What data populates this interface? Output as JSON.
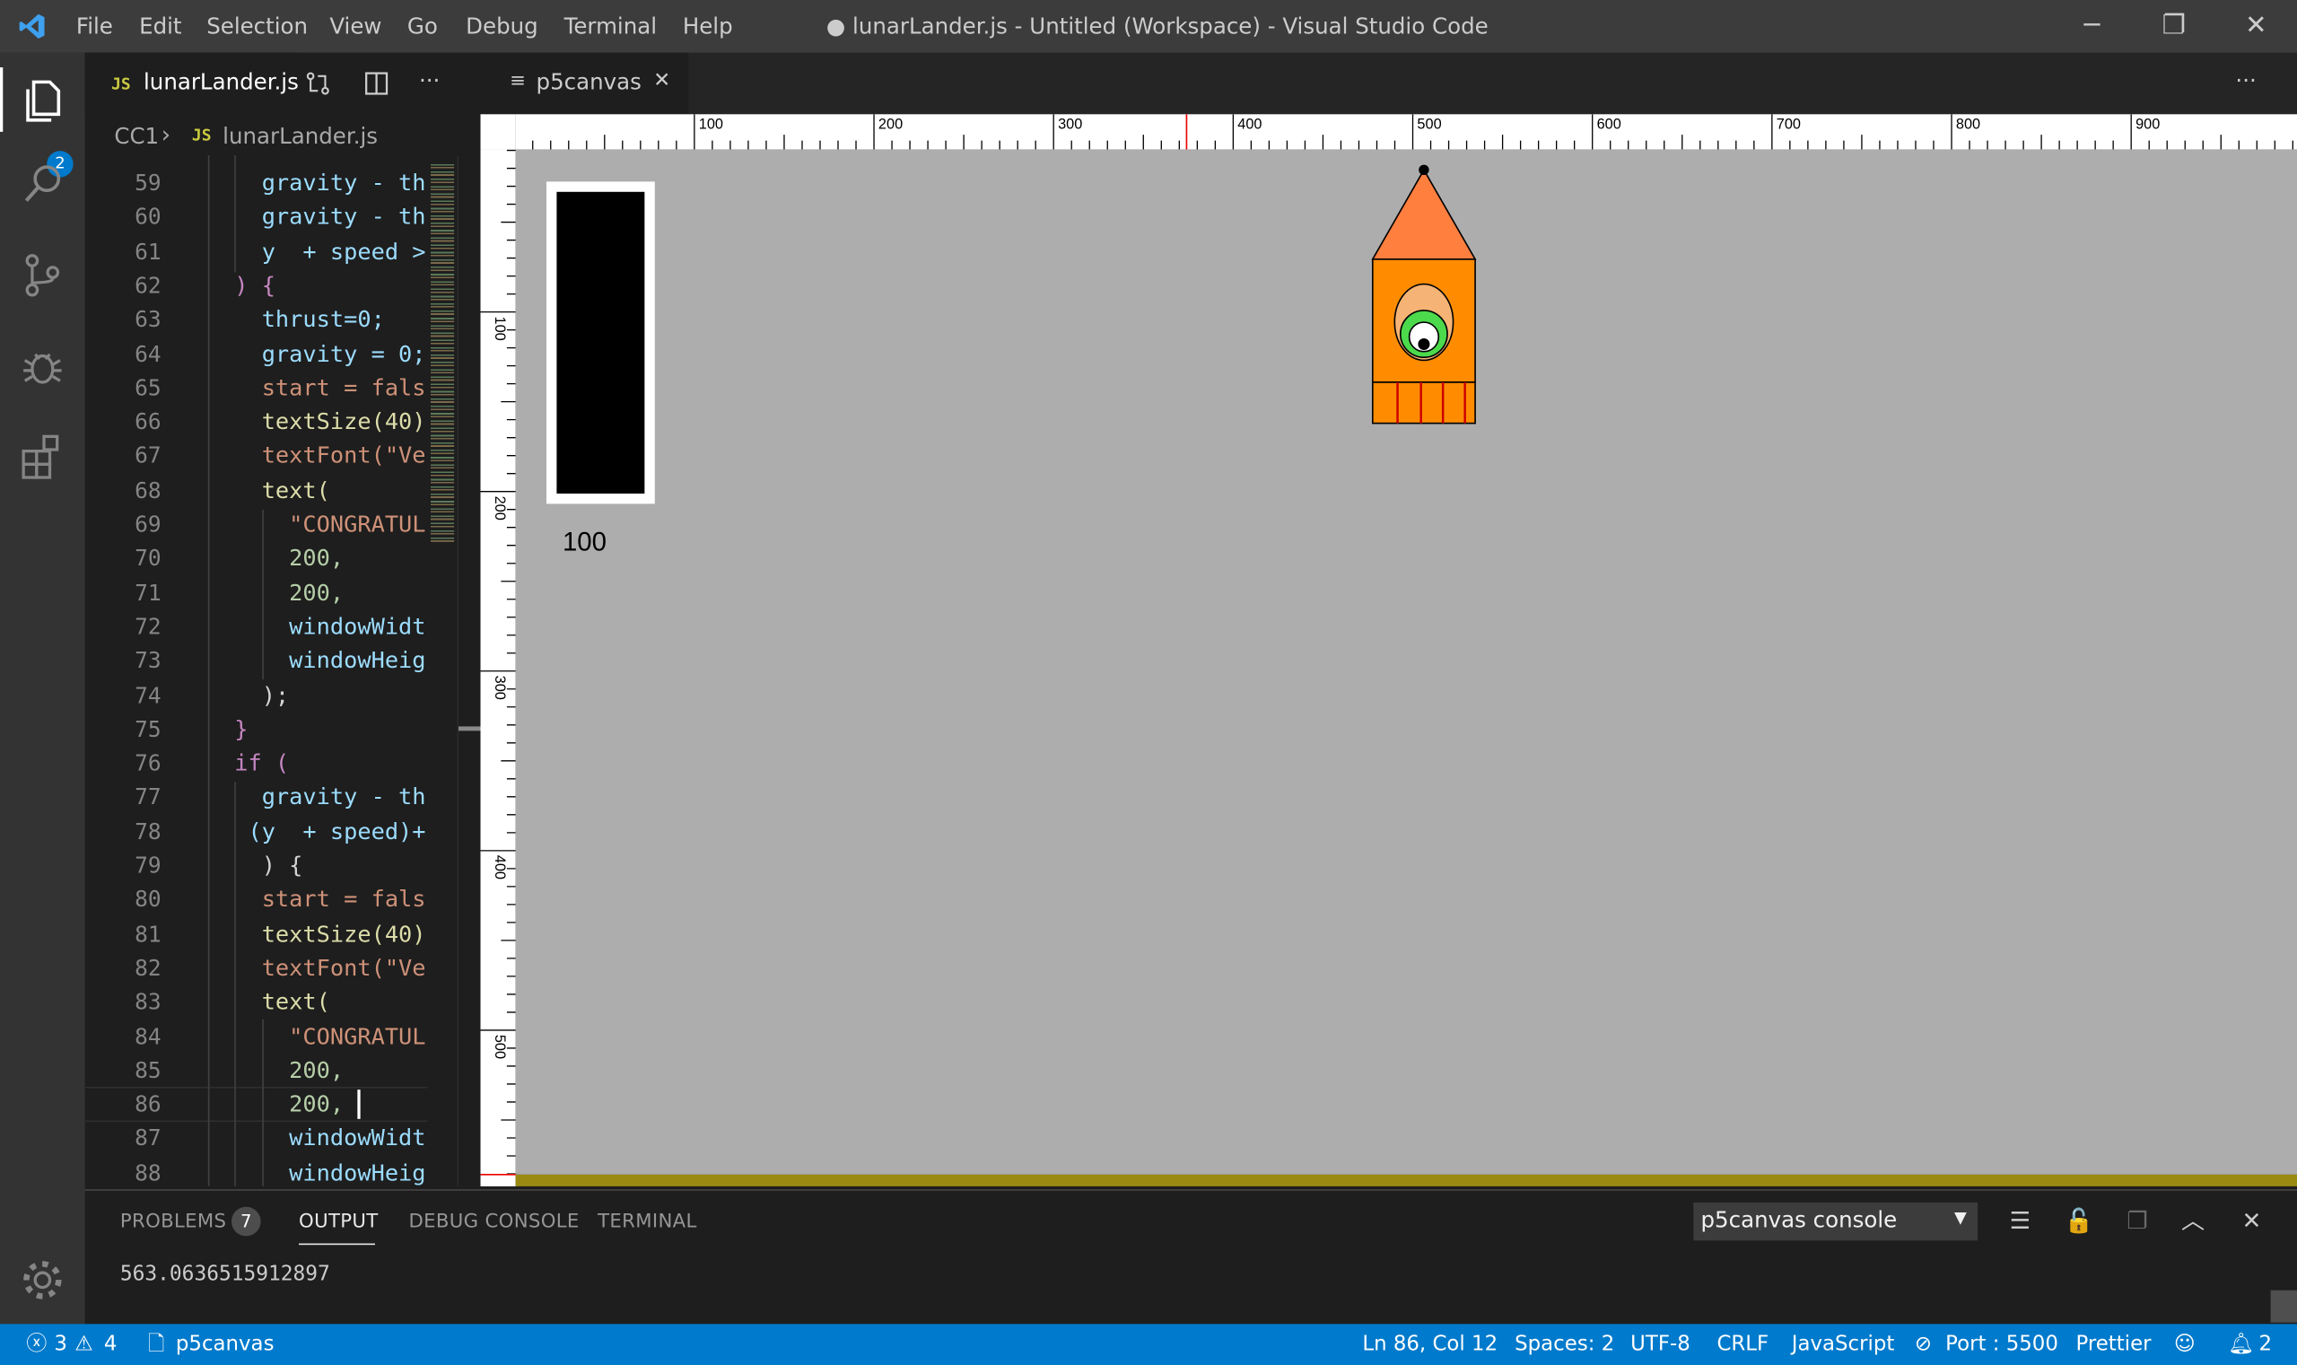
{
  "app": {
    "window_title": "● lunarLander.js - Untitled (Workspace) - Visual Studio Code",
    "menu": [
      "File",
      "Edit",
      "Selection",
      "View",
      "Go",
      "Debug",
      "Terminal",
      "Help"
    ],
    "window_controls": {
      "minimize": "─",
      "restore": "❐",
      "close": "✕"
    }
  },
  "activity_bar": {
    "explorer_badge": "2",
    "items": [
      "files-icon",
      "search-icon",
      "source-control-icon",
      "debug-icon",
      "extensions-icon",
      "settings-gear-icon"
    ]
  },
  "left_editor": {
    "tab_label": "lunarLander.js",
    "tab_lang": "JS",
    "more_actions": "···",
    "breadcrumb": {
      "folder": "CC1",
      "lang": "JS",
      "file": "lunarLander.js"
    },
    "lines": [
      {
        "n": "59",
        "t": "  gravity - th"
      },
      {
        "n": "60",
        "t": "  gravity - th"
      },
      {
        "n": "61",
        "t": "  y  + speed >"
      },
      {
        "n": "62",
        "t": ") {"
      },
      {
        "n": "63",
        "t": "  thrust=0;"
      },
      {
        "n": "64",
        "t": "  gravity = 0;"
      },
      {
        "n": "65",
        "t": "  start = fals"
      },
      {
        "n": "66",
        "t": "  textSize(40)"
      },
      {
        "n": "67",
        "t": "  textFont(\"Ve"
      },
      {
        "n": "68",
        "t": "  text("
      },
      {
        "n": "69",
        "t": "    \"CONGRATUL"
      },
      {
        "n": "70",
        "t": "    200,"
      },
      {
        "n": "71",
        "t": "    200,"
      },
      {
        "n": "72",
        "t": "    windowWidt"
      },
      {
        "n": "73",
        "t": "    windowHeig"
      },
      {
        "n": "74",
        "t": "  );"
      },
      {
        "n": "75",
        "t": "}"
      },
      {
        "n": "76",
        "t": "if ("
      },
      {
        "n": "77",
        "t": "  gravity - th"
      },
      {
        "n": "78",
        "t": " (y  + speed)+"
      },
      {
        "n": "79",
        "t": "  ) {"
      },
      {
        "n": "80",
        "t": "  start = fals"
      },
      {
        "n": "81",
        "t": "  textSize(40)"
      },
      {
        "n": "82",
        "t": "  textFont(\"Ve"
      },
      {
        "n": "83",
        "t": "  text("
      },
      {
        "n": "84",
        "t": "    \"CONGRATUL"
      },
      {
        "n": "85",
        "t": "    200,"
      },
      {
        "n": "86",
        "t": "    200, "
      },
      {
        "n": "87",
        "t": "    windowWidt"
      },
      {
        "n": "88",
        "t": "    windowHeig"
      }
    ]
  },
  "right_editor": {
    "tab_label": "p5canvas",
    "tab_close": "✕",
    "more_actions": "···",
    "ruler_top_labels": [
      "100",
      "200",
      "300",
      "400",
      "500",
      "600",
      "700",
      "800",
      "900"
    ],
    "ruler_left_labels": [
      "100",
      "200",
      "300",
      "400",
      "500"
    ],
    "canvas": {
      "fuel_value": "100",
      "background": "#adadad",
      "lander_colors": {
        "nose": "#ff7f3f",
        "body": "#ff8c00",
        "window": "#f5b475",
        "eye": "#4cd94c"
      }
    }
  },
  "panel": {
    "tabs": [
      {
        "label": "PROBLEMS",
        "badge": "7"
      },
      {
        "label": "OUTPUT",
        "active": true
      },
      {
        "label": "DEBUG CONSOLE"
      },
      {
        "label": "TERMINAL"
      }
    ],
    "output_channel": "p5canvas console",
    "output_text": "563.0636515912897"
  },
  "status_bar": {
    "errors": "3",
    "warnings": "4",
    "p5": "p5canvas",
    "position": "Ln 86, Col 12",
    "spaces": "Spaces: 2",
    "encoding": "UTF-8",
    "eol": "CRLF",
    "language": "JavaScript",
    "port": "Port : 5500",
    "formatter": "Prettier",
    "notifications": "2"
  },
  "colors": {
    "accent": "#007acc",
    "titlebar": "#3c3c3c",
    "activitybar": "#333333",
    "editor_bg": "#1e1e1e"
  }
}
